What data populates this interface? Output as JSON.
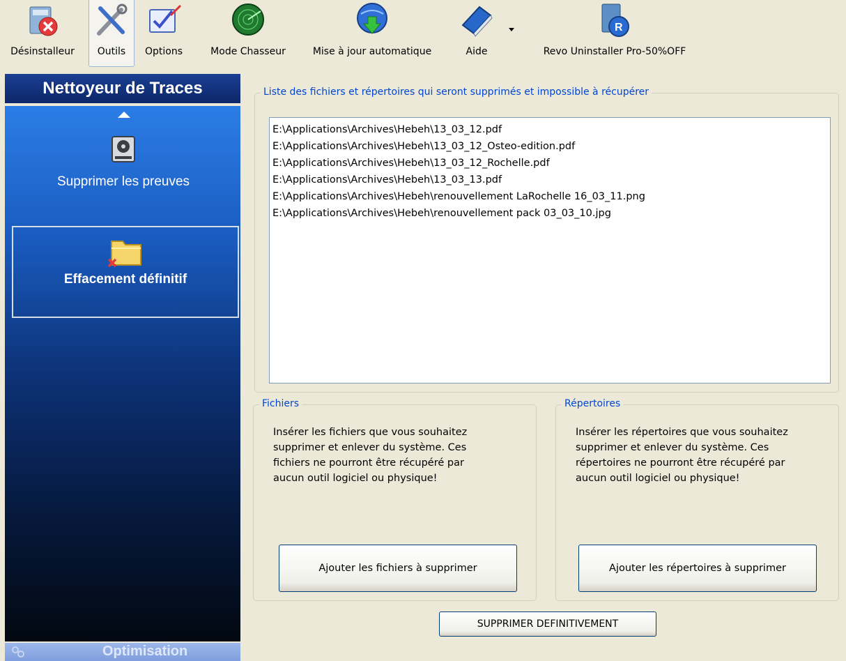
{
  "toolbar": {
    "items": [
      {
        "label": "Désinstalleur",
        "icon": "uninstaller-icon"
      },
      {
        "label": "Outils",
        "icon": "tools-icon",
        "active": true
      },
      {
        "label": "Options",
        "icon": "options-icon"
      },
      {
        "label": "Mode Chasseur",
        "icon": "radar-icon"
      },
      {
        "label": "Mise à jour automatique",
        "icon": "update-globe-icon"
      },
      {
        "label": "Aide",
        "icon": "help-book-icon"
      },
      {
        "label": "Revo Uninstaller Pro-50%OFF",
        "icon": "revo-pro-icon"
      }
    ]
  },
  "sidebar": {
    "title": "Nettoyeur de Traces",
    "items": [
      {
        "label": "Supprimer les preuves",
        "icon": "hard-drive-icon"
      },
      {
        "label": "Effacement définitif",
        "icon": "folder-delete-icon",
        "selected": true
      }
    ],
    "footer_label": "Optimisation"
  },
  "list_group": {
    "title": "Liste des fichiers et répertoires qui seront supprimés et impossible à récupérer",
    "files": [
      "E:\\Applications\\Archives\\Hebeh\\13_03_12.pdf",
      "E:\\Applications\\Archives\\Hebeh\\13_03_12_Osteo-edition.pdf",
      "E:\\Applications\\Archives\\Hebeh\\13_03_12_Rochelle.pdf",
      "E:\\Applications\\Archives\\Hebeh\\13_03_13.pdf",
      "E:\\Applications\\Archives\\Hebeh\\renouvellement LaRochelle 16_03_11.png",
      "E:\\Applications\\Archives\\Hebeh\\renouvellement pack 03_03_10.jpg"
    ]
  },
  "files_group": {
    "title": "Fichiers",
    "description": "Insérer les fichiers que vous souhaitez supprimer et enlever du système. Ces fichiers ne pourront être récupéré par aucun outil logiciel ou physique!",
    "button_label": "Ajouter les fichiers à supprimer"
  },
  "dirs_group": {
    "title": "Répertoires",
    "description": "Insérer les répertoires que vous souhaitez supprimer et enlever du système. Ces répertoires ne pourront être récupéré par aucun outil logiciel ou physique!",
    "button_label": "Ajouter les répertoires à supprimer"
  },
  "delete_button_label": "SUPPRIMER DEFINITIVEMENT",
  "colors": {
    "window_bg": "#ece9d8",
    "group_title": "#0046d5",
    "sidebar_header": "#1b3f93",
    "sidebar_top": "#2b7de6"
  }
}
